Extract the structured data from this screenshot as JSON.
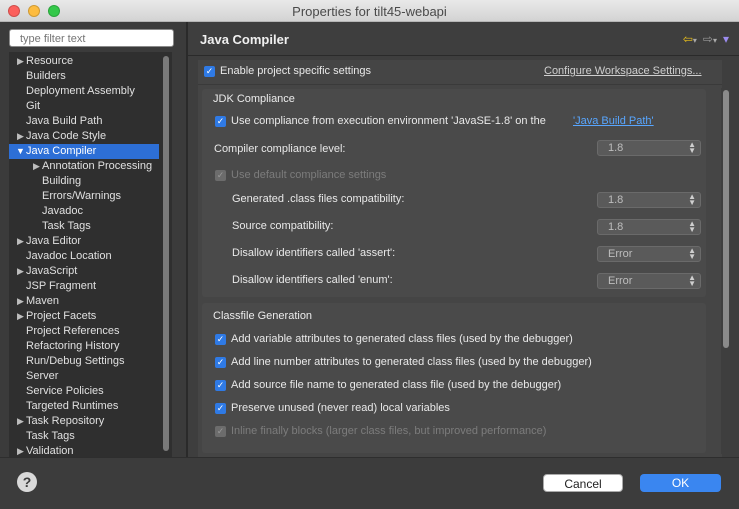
{
  "window": {
    "title": "Properties for tilt45-webapi"
  },
  "filter": {
    "placeholder": "type filter text"
  },
  "tree": {
    "items": [
      {
        "label": "Resource",
        "arrow": "▶"
      },
      {
        "label": "Builders",
        "arrow": ""
      },
      {
        "label": "Deployment Assembly",
        "arrow": ""
      },
      {
        "label": "Git",
        "arrow": ""
      },
      {
        "label": "Java Build Path",
        "arrow": ""
      },
      {
        "label": "Java Code Style",
        "arrow": "▶"
      },
      {
        "label": "Java Compiler",
        "arrow": "▼"
      },
      {
        "label": "Annotation Processing",
        "arrow": "▶"
      },
      {
        "label": "Building",
        "arrow": ""
      },
      {
        "label": "Errors/Warnings",
        "arrow": ""
      },
      {
        "label": "Javadoc",
        "arrow": ""
      },
      {
        "label": "Task Tags",
        "arrow": ""
      },
      {
        "label": "Java Editor",
        "arrow": "▶"
      },
      {
        "label": "Javadoc Location",
        "arrow": ""
      },
      {
        "label": "JavaScript",
        "arrow": "▶"
      },
      {
        "label": "JSP Fragment",
        "arrow": ""
      },
      {
        "label": "Maven",
        "arrow": "▶"
      },
      {
        "label": "Project Facets",
        "arrow": "▶"
      },
      {
        "label": "Project References",
        "arrow": ""
      },
      {
        "label": "Refactoring History",
        "arrow": ""
      },
      {
        "label": "Run/Debug Settings",
        "arrow": ""
      },
      {
        "label": "Server",
        "arrow": ""
      },
      {
        "label": "Service Policies",
        "arrow": ""
      },
      {
        "label": "Targeted Runtimes",
        "arrow": ""
      },
      {
        "label": "Task Repository",
        "arrow": "▶"
      },
      {
        "label": "Task Tags",
        "arrow": ""
      },
      {
        "label": "Validation",
        "arrow": "▶"
      }
    ]
  },
  "page": {
    "title": "Java Compiler",
    "nav_back": "⇦",
    "nav_forward": "⇨",
    "menu": "▾"
  },
  "settings": {
    "enable_label": "Enable project specific settings",
    "configure_link": "Configure Workspace Settings...",
    "jdk": {
      "title": "JDK Compliance",
      "use_ee_label": "Use compliance from execution environment 'JavaSE-1.8' on the ",
      "build_path_link": "'Java Build Path'",
      "level_label": "Compiler compliance level:",
      "level_value": "1.8",
      "use_default_label": "Use default compliance settings",
      "generated_label": "Generated .class files compatibility:",
      "generated_value": "1.8",
      "source_label": "Source compatibility:",
      "source_value": "1.8",
      "assert_label": "Disallow identifiers called 'assert':",
      "assert_value": "Error",
      "enum_label": "Disallow identifiers called 'enum':",
      "enum_value": "Error"
    },
    "classfile": {
      "title": "Classfile Generation",
      "items": [
        "Add variable attributes to generated class files (used by the debugger)",
        "Add line number attributes to generated class files (used by the debugger)",
        "Add source file name to generated class file (used by the debugger)",
        "Preserve unused (never read) local variables",
        "Inline finally blocks (larger class files, but improved performance)"
      ]
    }
  },
  "footer": {
    "help": "?",
    "cancel_label": "Cancel",
    "ok_label": "OK"
  },
  "colors": {
    "accent": "#2f7ae5",
    "selection": "#2d6fd6",
    "link": "#58a6ff"
  }
}
